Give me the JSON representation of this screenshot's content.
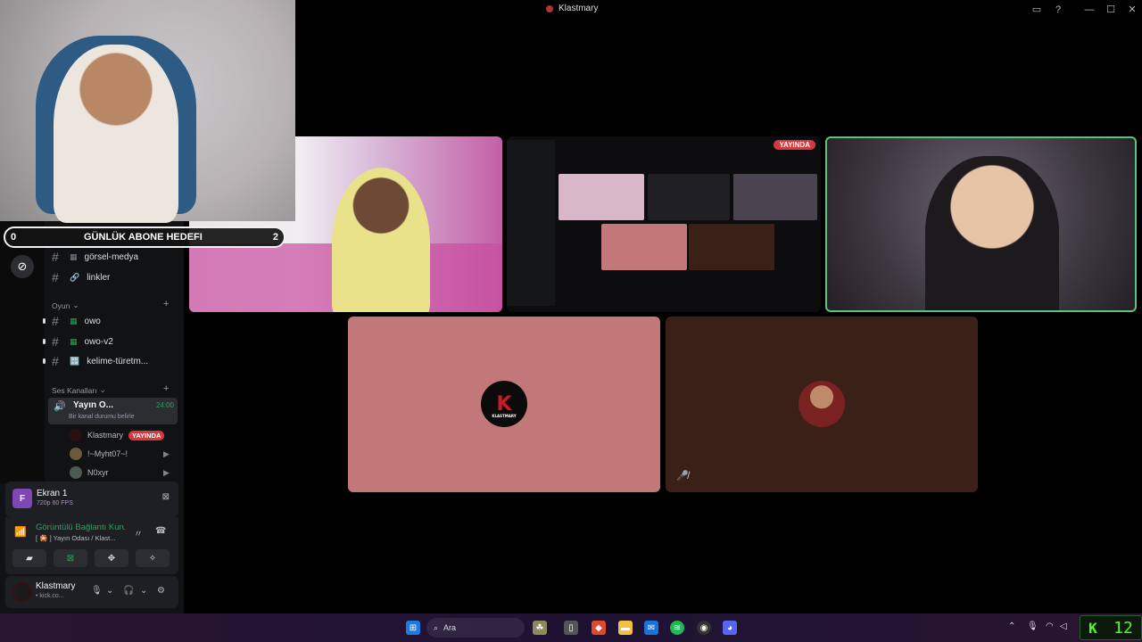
{
  "window": {
    "title": "Klastmary"
  },
  "goal_overlay": {
    "left_value": "0",
    "label": "GÜNLÜK ABONE HEDEFI",
    "right_value": "2"
  },
  "channels": [
    {
      "emoji": "▦",
      "name": "görsel-medya"
    },
    {
      "emoji": "🔗",
      "name": "linkler"
    }
  ],
  "category_game": {
    "label": "Oyun"
  },
  "game_channels": [
    {
      "emoji": "▦",
      "name": "owo"
    },
    {
      "emoji": "▦",
      "name": "owo-v2"
    },
    {
      "emoji": "🔡",
      "name": "kelime-türetm..."
    }
  ],
  "category_voice": {
    "label": "Ses Kanalları"
  },
  "voice_channel": {
    "name": "Yayın O...",
    "timer": "24:00",
    "status": "Bir kanal durumu belirle"
  },
  "voice_users": [
    {
      "name": "Klastmary",
      "badge": "YAYINDA"
    },
    {
      "name": "!~Myht07~!"
    },
    {
      "name": "N0xyr"
    }
  ],
  "stream_panel": {
    "initial": "F",
    "name": "Ekran 1",
    "quality": "720p 60 FPS"
  },
  "connection": {
    "title": "Görüntülü Bağlantı Kuruldu",
    "subtitle": "[ 🎇 ] Yayın Odası / Klast..."
  },
  "user": {
    "name": "Klastmary",
    "status": "• kick.co..."
  },
  "screen_tile": {
    "badge": "YAYINDA"
  },
  "avatar_tile": {
    "label": "KLASTMARY"
  },
  "taskbar": {
    "search_label": "Ara"
  },
  "kick_widget": {
    "letter": "K",
    "count": "12"
  },
  "colors": {
    "accent": "#da373c",
    "discord_green": "#23a559",
    "kick_green": "#53fc18"
  }
}
